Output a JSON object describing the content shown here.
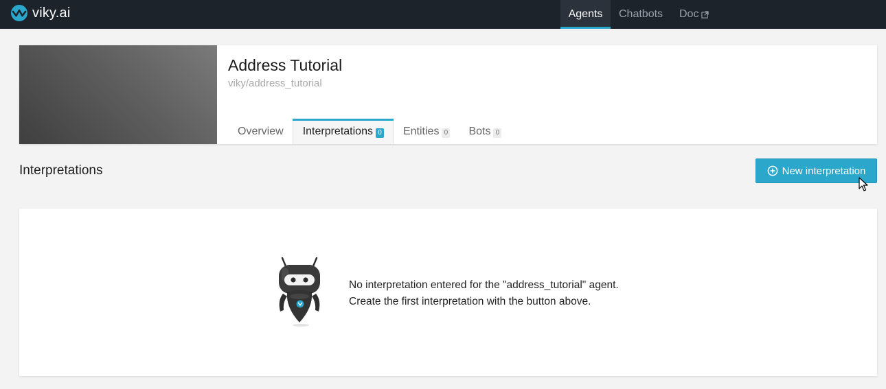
{
  "brand": {
    "name": "viky",
    "tld": ".ai"
  },
  "nav": {
    "agents": "Agents",
    "chatbots": "Chatbots",
    "doc": "Doc"
  },
  "agent": {
    "title": "Address Tutorial",
    "slug": "viky/address_tutorial"
  },
  "tabs": [
    {
      "label": "Overview",
      "count": null
    },
    {
      "label": "Interpretations",
      "count": "0"
    },
    {
      "label": "Entities",
      "count": "0"
    },
    {
      "label": "Bots",
      "count": "0"
    }
  ],
  "section": {
    "title": "Interpretations",
    "new_button": "New interpretation"
  },
  "empty_state": {
    "line1": "No interpretation entered for the \"address_tutorial\" agent.",
    "line2": "Create the first interpretation with the button above."
  },
  "colors": {
    "accent": "#2aa7cb",
    "topbar": "#1d232b"
  },
  "icons": [
    "viky-logo-icon",
    "external-link-icon",
    "plus-circle-icon",
    "mouse-cursor-icon",
    "robot-illustration"
  ]
}
